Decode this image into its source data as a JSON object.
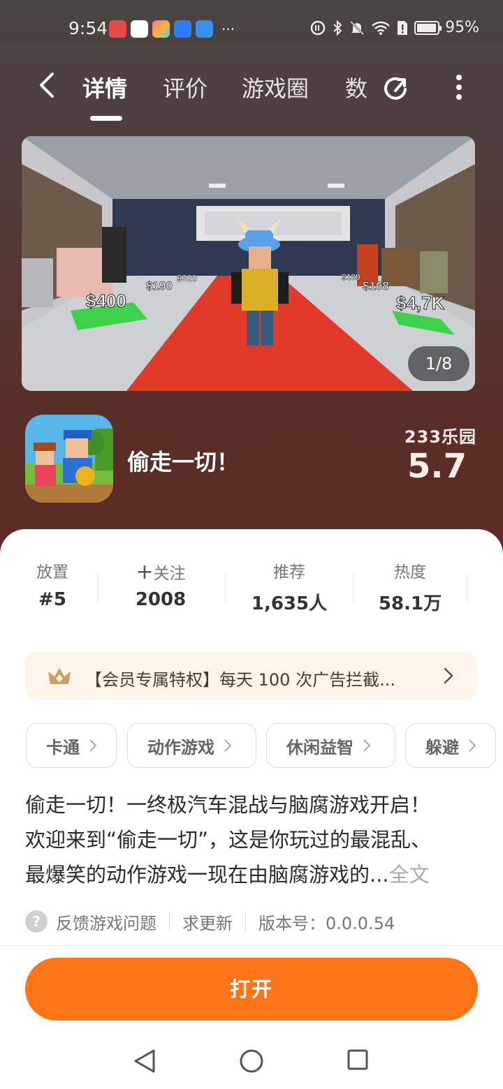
{
  "status_bar": {
    "time": "9:54",
    "battery": "95%",
    "more": "···"
  },
  "nav": {
    "tabs": [
      "详情",
      "评价",
      "游戏圈",
      "数"
    ],
    "active_tab": "详情"
  },
  "gallery": {
    "counter": "1/8",
    "price_labels": [
      "$400",
      "$190",
      "$320",
      "$168",
      "$4,7K",
      "$189"
    ]
  },
  "app": {
    "name": "偷走一切！",
    "store": "233乐园",
    "score": "5.7"
  },
  "stats": [
    {
      "label": "放置",
      "value": "#5"
    },
    {
      "label": "关注",
      "value": "2008"
    },
    {
      "label": "推荐",
      "value": "1,635人"
    },
    {
      "label": "热度",
      "value": "58.1万"
    }
  ],
  "vip": {
    "text": "【会员专属特权】每天 100 次广告拦截..."
  },
  "tags": [
    "卡通",
    "动作游戏",
    "休闲益智",
    "躲避"
  ],
  "description": {
    "lines": [
      "偷走一切！一终极汽车混战与脑腐游戏开启！",
      "欢迎来到“偷走一切”，这是你玩过的最混乱、",
      "最爆笑的动作游戏一现在由脑腐游戏的..."
    ],
    "more": "全文"
  },
  "meta": {
    "feedback": "反馈游戏问题",
    "update": "求更新",
    "version": "版本号：0.0.0.54"
  },
  "cta": {
    "open": "打开"
  },
  "colors": {
    "accent": "#ff7416",
    "header_bg": "#5a2f29"
  }
}
